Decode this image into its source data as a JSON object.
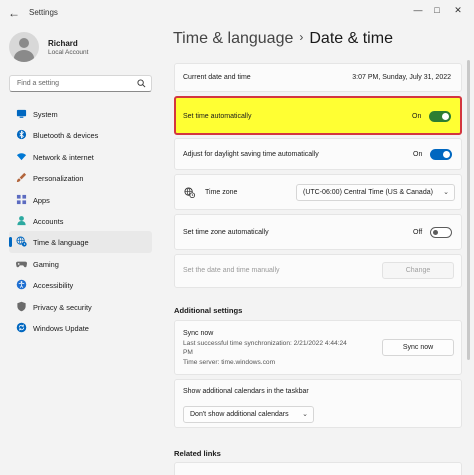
{
  "window": {
    "title": "Settings"
  },
  "user": {
    "name": "Richard",
    "account": "Local Account"
  },
  "search": {
    "placeholder": "Find a setting"
  },
  "sidebar": {
    "items": [
      {
        "label": "System",
        "icon": "monitor-icon",
        "color": "#0067c0"
      },
      {
        "label": "Bluetooth & devices",
        "icon": "bluetooth-icon",
        "color": "#0067c0"
      },
      {
        "label": "Network & internet",
        "icon": "wifi-icon",
        "color": "#0078d4"
      },
      {
        "label": "Personalization",
        "icon": "brush-icon",
        "color": "#b2653c"
      },
      {
        "label": "Apps",
        "icon": "apps-icon",
        "color": "#5c6bc0"
      },
      {
        "label": "Accounts",
        "icon": "person-icon",
        "color": "#2ca9a0"
      },
      {
        "label": "Time & language",
        "icon": "globe-clock-icon",
        "color": "#0067c0"
      },
      {
        "label": "Gaming",
        "icon": "gamepad-icon",
        "color": "#6b6b6b"
      },
      {
        "label": "Accessibility",
        "icon": "accessibility-icon",
        "color": "#1f6fd1"
      },
      {
        "label": "Privacy & security",
        "icon": "shield-icon",
        "color": "#6b6b6b"
      },
      {
        "label": "Windows Update",
        "icon": "sync-icon",
        "color": "#0067c0"
      }
    ],
    "active_index": 6
  },
  "breadcrumb": {
    "parent": "Time & language",
    "separator": "›",
    "current": "Date & time"
  },
  "settings": {
    "current_label": "Current date and time",
    "current_value": "3:07 PM, Sunday, July 31, 2022",
    "set_auto_label": "Set time automatically",
    "set_auto_state": "On",
    "dst_label": "Adjust for daylight saving time automatically",
    "dst_state": "On",
    "timezone_label": "Time zone",
    "timezone_value": "(UTC-06:00) Central Time (US & Canada)",
    "tz_auto_label": "Set time zone automatically",
    "tz_auto_state": "Off",
    "manual_label": "Set the date and time manually",
    "change_button": "Change"
  },
  "additional": {
    "heading": "Additional settings",
    "sync_title": "Sync now",
    "sync_line1": "Last successful time synchronization: 2/21/2022 4:44:24",
    "sync_line2": "PM",
    "sync_line3": "Time server: time.windows.com",
    "sync_button": "Sync now",
    "calendars_label": "Show additional calendars in the taskbar",
    "calendars_value": "Don't show additional calendars"
  },
  "related": {
    "heading": "Related links"
  },
  "colors": {
    "accent": "#0067c0",
    "highlight": "#ffff33",
    "highlight_border": "#d3363f",
    "toggle_on_highlighted": "#2e7d32"
  }
}
